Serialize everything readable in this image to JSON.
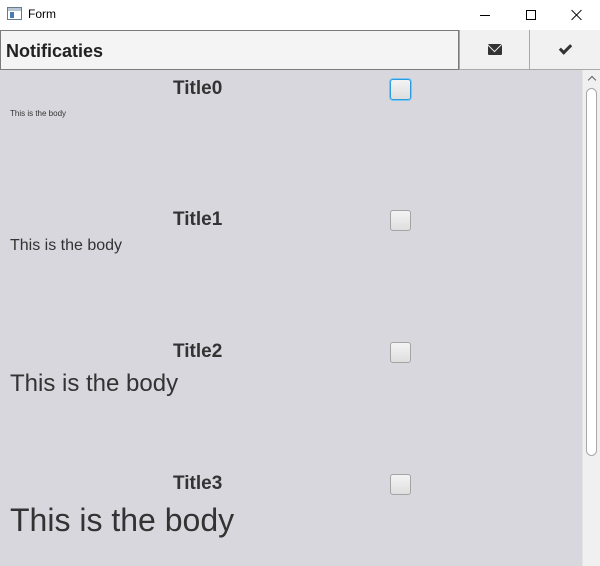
{
  "window": {
    "title": "Form"
  },
  "toolbar": {
    "heading": "Notificaties",
    "buttons": [
      {
        "icon": "envelope-icon"
      },
      {
        "icon": "check-icon"
      }
    ]
  },
  "notifications": [
    {
      "title": "Title0",
      "body": "This is the body",
      "checked": false,
      "focused": true
    },
    {
      "title": "Title1",
      "body": "This is the body",
      "checked": false,
      "focused": false
    },
    {
      "title": "Title2",
      "body": "This is the body",
      "checked": false,
      "focused": false
    },
    {
      "title": "Title3",
      "body": "This is the body",
      "checked": false,
      "focused": false
    }
  ],
  "colors": {
    "content_background": "#d8d7dd",
    "focus_accent": "#2b9be0",
    "text": "#333333"
  }
}
